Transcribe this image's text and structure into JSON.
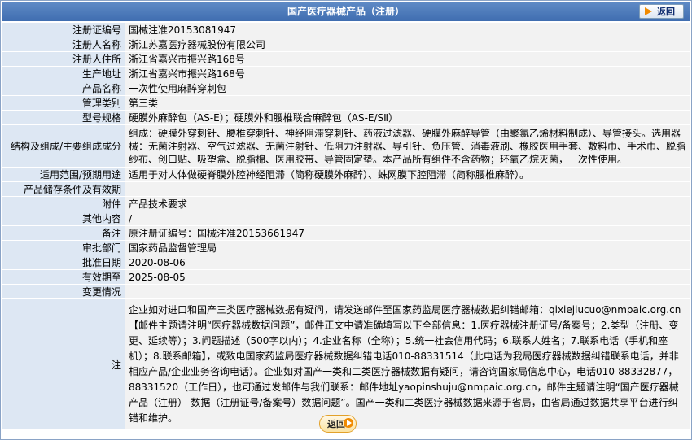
{
  "header": {
    "title": "国产医疗器械产品（注册）",
    "back_label": "返回"
  },
  "rows": [
    {
      "label": "注册证编号",
      "value": "国械注准20153081947"
    },
    {
      "label": "注册人名称",
      "value": "浙江苏嘉医疗器械股份有限公司"
    },
    {
      "label": "注册人住所",
      "value": "浙江省嘉兴市振兴路168号"
    },
    {
      "label": "生产地址",
      "value": "浙江省嘉兴市振兴路168号"
    },
    {
      "label": "产品名称",
      "value": "一次性使用麻醉穿刺包"
    },
    {
      "label": "管理类别",
      "value": "第三类"
    },
    {
      "label": "型号规格",
      "value": "硬膜外麻醉包（AS-E）；硬膜外和腰椎联合麻醉包（AS-E/SⅡ）"
    },
    {
      "label": "结构及组成/主要组成成分",
      "value": "组成：硬膜外穿刺针、腰椎穿刺针、神经阻滞穿刺针、药液过滤器、硬膜外麻醉导管（由聚氯乙烯材料制成）、导管接头。选用器械：无菌注射器、空气过滤器、无菌注射针、低阻力注射器、导引针、负压管、消毒液刷、橡胶医用手套、敷料巾、手术巾、脱脂纱布、创口贴、吸塑盒、脱脂棉、医用胶带、导管固定垫。本产品所有组件不含药物；环氧乙烷灭菌，一次性使用。"
    },
    {
      "label": "适用范围/预期用途",
      "value": "适用于对人体做硬脊膜外腔神经阻滞（简称硬膜外麻醉）、蛛网膜下腔阻滞（简称腰椎麻醉）。"
    },
    {
      "label": "产品储存条件及有效期",
      "value": ""
    },
    {
      "label": "附件",
      "value": "产品技术要求"
    },
    {
      "label": "其他内容",
      "value": "/"
    },
    {
      "label": "备注",
      "value": "原注册证编号：国械注准20153661947"
    },
    {
      "label": "审批部门",
      "value": "国家药品监督管理局"
    },
    {
      "label": "批准日期",
      "value": "2020-08-06"
    },
    {
      "label": "有效期至",
      "value": "2025-08-05"
    },
    {
      "label": "变更情况",
      "value": ""
    }
  ],
  "note": {
    "label": "注",
    "text": "企业如对进口和国产三类医疗器械数据有疑问，请发送邮件至国家药监局医疗器械数据纠错邮箱：qixiejiucuo@nmpaic.org.cn【邮件主题请注明“医疗器械数据问题”，邮件正文中请准确填写以下全部信息：1.医疗器械注册证号/备案号；2.类型（注册、变更、延续等）；3.问题描述（500字以内）；4.企业名称（全称）；5.统一社会信用代码；6.联系人姓名；7.联系电话（手机和座机）；8.联系邮箱】，或致电国家药监局医疗器械数据纠错电话010-88331514（此电话为我局医疗器械数据纠错联系电话，并非相应产品/企业业务咨询电话）。企业如对国产一类和二类医疗器械数据有疑问，请咨询国家局信息中心，电话010-88332877，88331520（工作日），也可通过发邮件与我们联系：邮件地址yaopinshuju@nmpaic.org.cn，邮件主题请注明“国产医疗器械产品（注册）-数据（注册证号/备案号）数据问题”。国产一类和二类医疗器械数据来源于省局，由省局通过数据共享平台进行纠错和维护。"
  },
  "footer": {
    "back_label": "返回"
  }
}
